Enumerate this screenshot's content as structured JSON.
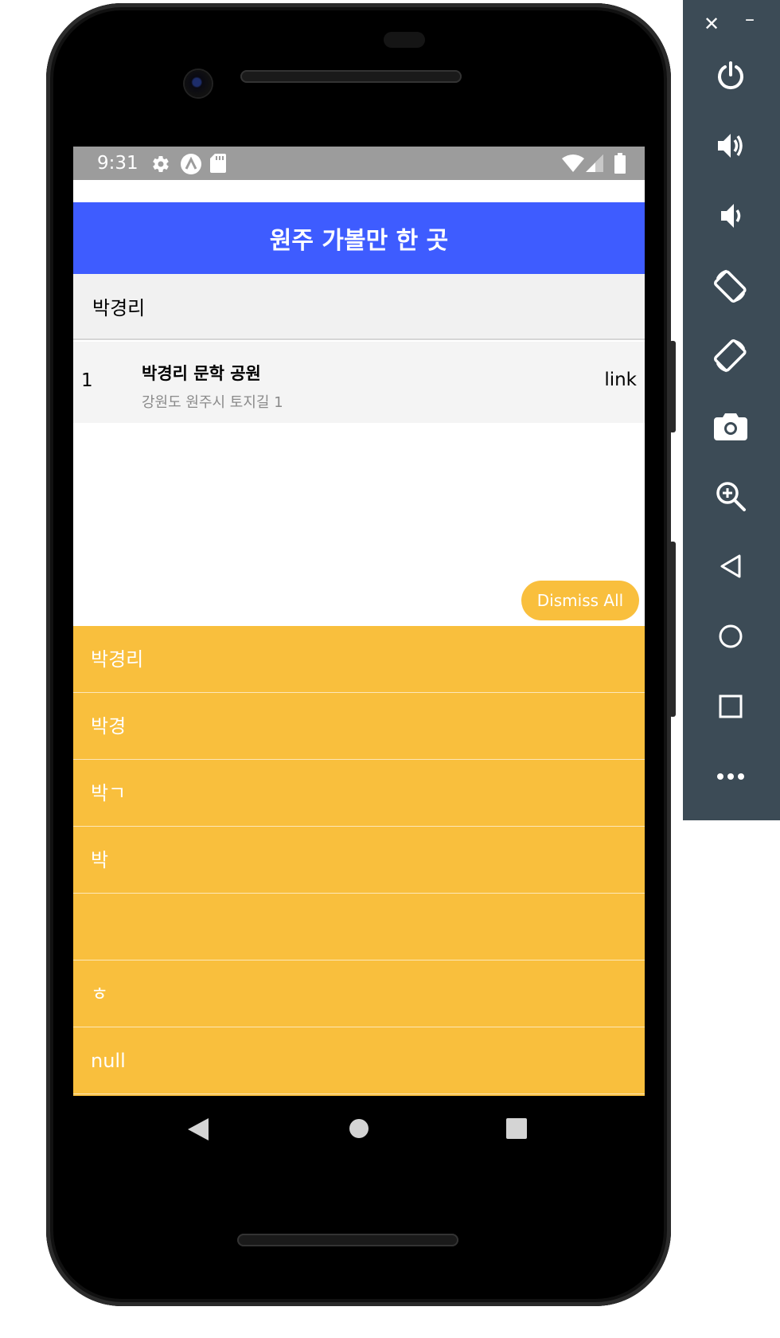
{
  "status_bar": {
    "time": "9:31",
    "left_icons": [
      "gear-icon",
      "a-circle-icon",
      "sd-card-icon"
    ],
    "right_icons": [
      "wifi-icon",
      "signal-icon",
      "battery-icon"
    ]
  },
  "app_bar": {
    "title": "원주 가볼만 한 곳"
  },
  "search": {
    "value": "박경리"
  },
  "results": [
    {
      "index": "1",
      "name": "박경리 문학 공원",
      "address": "강원도 원주시 토지길 1",
      "link": "link"
    }
  ],
  "dismiss_button": {
    "label": "Dismiss All"
  },
  "history": [
    "박경리",
    "박경",
    "박ㄱ",
    "박",
    "",
    "ㅎ",
    "null"
  ],
  "colors": {
    "accent_blue": "#3e5cff",
    "history_bg": "#f9bf3d",
    "status_bar": "#9c9c9c",
    "emulator_panel": "#3c4b56"
  },
  "emulator_panel": {
    "buttons": [
      "power-icon",
      "volume-up-icon",
      "volume-down-icon",
      "rotate-left-icon",
      "rotate-right-icon",
      "camera-icon",
      "zoom-icon",
      "back-icon",
      "home-icon",
      "overview-icon",
      "more-icon"
    ]
  },
  "navigation": [
    "back-icon",
    "home-icon",
    "overview-icon"
  ]
}
